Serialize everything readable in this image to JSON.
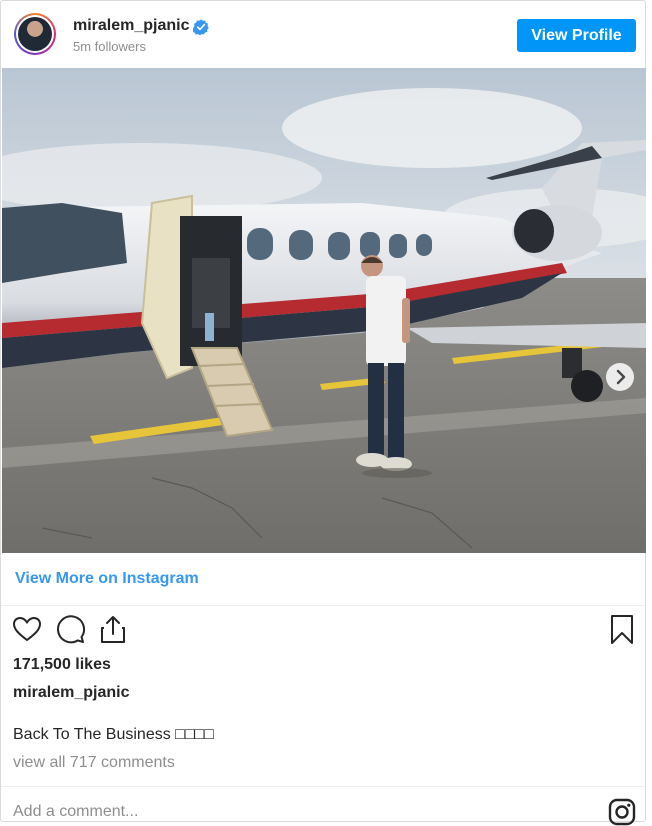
{
  "header": {
    "username": "miralem_pjanic",
    "followers": "5m followers",
    "view_profile_label": "View Profile",
    "verified_icon": "verified-badge-icon",
    "avatar_icon": "avatar"
  },
  "media": {
    "description_icon": "post-photo",
    "carousel_total": 2,
    "carousel_active_index": 0,
    "next_icon": "chevron-right-icon"
  },
  "links": {
    "view_more": "View More on Instagram"
  },
  "actions": {
    "like_icon": "heart-icon",
    "comment_icon": "comment-icon",
    "share_icon": "share-icon",
    "save_icon": "bookmark-icon"
  },
  "post": {
    "likes": "171,500 likes",
    "username": "miralem_pjanic",
    "caption": "Back To The Business □□□□",
    "view_comments": "view all 717 comments"
  },
  "comment": {
    "placeholder": "Add a comment..."
  },
  "colors": {
    "accent": "#0095f6",
    "link": "#3897f0",
    "text": "#262626",
    "muted": "#8e8e8e",
    "border": "#dbdbdb"
  }
}
